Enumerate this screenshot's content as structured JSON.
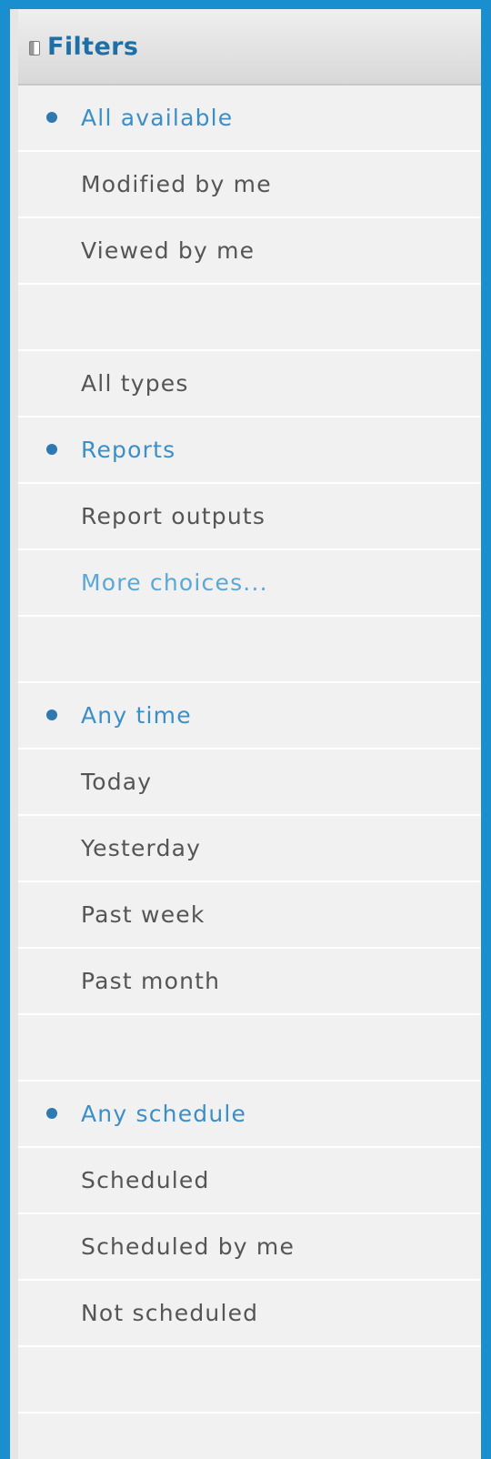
{
  "panel": {
    "title": "Filters",
    "icons": {
      "collapse": "panel-collapse-icon",
      "selected": "bullet-dot"
    },
    "colors": {
      "frame_border": "#1a8fcf",
      "title": "#1d6fa5",
      "selected_text": "#3b8fc6",
      "link_text": "#5aa8d6",
      "normal_text": "#555555",
      "bullet": "#2f79b2"
    }
  },
  "groups": [
    {
      "items": [
        {
          "label": "All available",
          "selected": true
        },
        {
          "label": "Modified by me",
          "selected": false
        },
        {
          "label": "Viewed by me",
          "selected": false
        }
      ]
    },
    {
      "items": [
        {
          "label": "All types",
          "selected": false
        },
        {
          "label": "Reports",
          "selected": true
        },
        {
          "label": "Report outputs",
          "selected": false
        },
        {
          "label": "More choices...",
          "selected": false,
          "link": true
        }
      ]
    },
    {
      "items": [
        {
          "label": "Any time",
          "selected": true
        },
        {
          "label": "Today",
          "selected": false
        },
        {
          "label": "Yesterday",
          "selected": false
        },
        {
          "label": "Past week",
          "selected": false
        },
        {
          "label": "Past month",
          "selected": false
        }
      ]
    },
    {
      "items": [
        {
          "label": "Any schedule",
          "selected": true
        },
        {
          "label": "Scheduled",
          "selected": false
        },
        {
          "label": "Scheduled by me",
          "selected": false
        },
        {
          "label": "Not scheduled",
          "selected": false
        }
      ]
    }
  ]
}
